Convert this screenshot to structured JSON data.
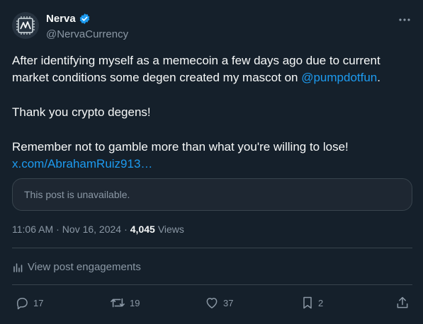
{
  "author": {
    "display_name": "Nerva",
    "handle": "@NervaCurrency",
    "verified_icon": "verified-badge-icon",
    "avatar_icon": "nerva-logo-icon"
  },
  "post": {
    "line1": "After identifying myself as a memecoin a few days ago due to current market conditions some degen created my mascot on ",
    "mention": "@pumpdotfun",
    "line1_end": ".",
    "line2": "Thank you crypto degens!",
    "line3": "Remember not to gamble more than what you're willing to lose!",
    "link": "x.com/AbrahamRuiz913…"
  },
  "quoted": {
    "text": "This post is unavailable."
  },
  "meta": {
    "time": "11:06 AM",
    "separator": "·",
    "date": "Nov 16, 2024",
    "views_count": "4,045",
    "views_label": "Views"
  },
  "engagements": {
    "label": "View post engagements"
  },
  "actions": {
    "replies": "17",
    "reposts": "19",
    "likes": "37",
    "bookmarks": "2"
  },
  "colors": {
    "background": "#15202b",
    "text": "#f7f9f9",
    "secondary": "#8b98a5",
    "accent": "#1d9bf0",
    "border": "#38444d"
  }
}
